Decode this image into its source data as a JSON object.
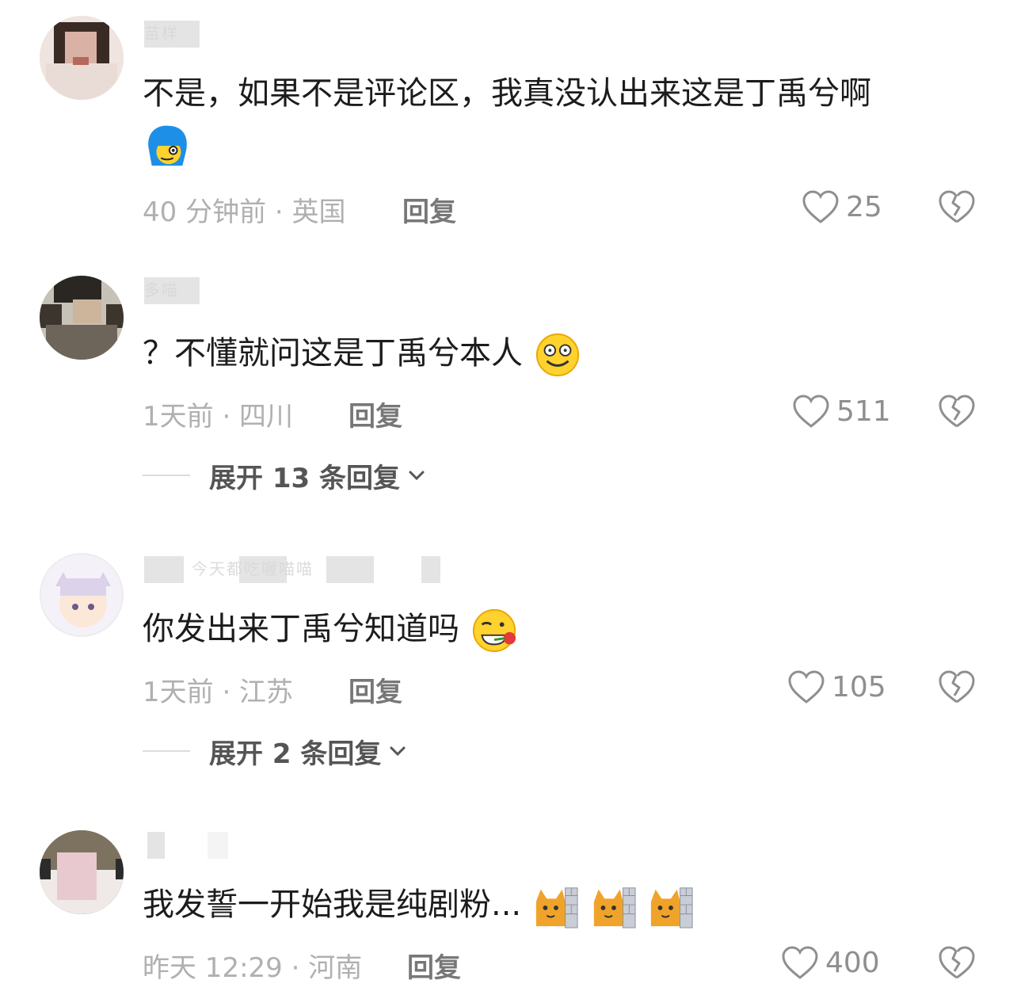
{
  "comments": [
    {
      "username": "苗样",
      "text": "不是，如果不是评论区，我真没认出来这是丁禹兮啊",
      "emoji": "blue-hair-wink-emoji",
      "time_location": "40 分钟前 · 英国",
      "reply_label": "回复",
      "likes": "25"
    },
    {
      "username": "多喵",
      "text": "？不懂就问这是丁禹兮本人",
      "emoji": "dizzy-smile-emoji",
      "time_location": "1天前 · 四川",
      "reply_label": "回复",
      "likes": "511",
      "expand_label": "展开 13 条回复"
    },
    {
      "username": "今天都吃喔喵喵",
      "text": "你发出来丁禹兮知道吗",
      "emoji": "rose-grin-emoji",
      "time_location": "1天前 · 江苏",
      "reply_label": "回复",
      "likes": "105",
      "expand_label": "展开 2 条回复"
    },
    {
      "username": "",
      "text": "我发誓一开始我是纯剧粉...",
      "emoji": "peeking-cat-emoji",
      "time_location": "昨天 12:29 · 河南",
      "reply_label": "回复",
      "likes": "400"
    }
  ],
  "colors": {
    "meta": "#b0b0b0",
    "reply": "#777777",
    "like_icon": "#8f8f8f"
  }
}
